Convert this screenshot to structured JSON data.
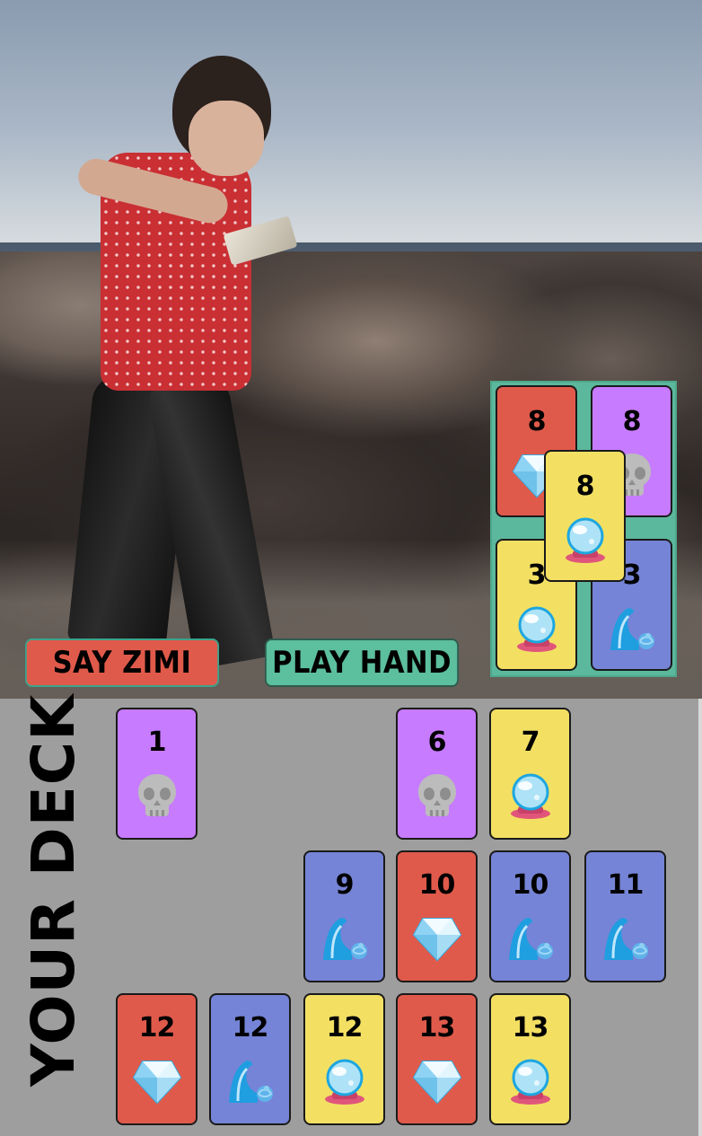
{
  "buttons": {
    "say_zimi": "SAY ZIMI",
    "play_hand": "PLAY HAND"
  },
  "deck": {
    "label": "YOUR DECK",
    "cards": [
      {
        "value": "1",
        "color": "purple",
        "icon": "skull-icon"
      },
      {
        "value": "6",
        "color": "purple",
        "icon": "skull-icon"
      },
      {
        "value": "7",
        "color": "yellow",
        "icon": "crystal-ball-icon"
      },
      {
        "value": "9",
        "color": "blue",
        "icon": "wave-icon"
      },
      {
        "value": "10",
        "color": "red",
        "icon": "diamond-icon"
      },
      {
        "value": "10",
        "color": "blue",
        "icon": "wave-icon"
      },
      {
        "value": "11",
        "color": "blue",
        "icon": "wave-icon"
      },
      {
        "value": "12",
        "color": "red",
        "icon": "diamond-icon"
      },
      {
        "value": "12",
        "color": "blue",
        "icon": "wave-icon"
      },
      {
        "value": "12",
        "color": "yellow",
        "icon": "crystal-ball-icon"
      },
      {
        "value": "13",
        "color": "red",
        "icon": "diamond-icon"
      },
      {
        "value": "13",
        "color": "yellow",
        "icon": "crystal-ball-icon"
      }
    ]
  },
  "table": {
    "cards": [
      {
        "value": "8",
        "color": "red",
        "icon": "diamond-icon"
      },
      {
        "value": "8",
        "color": "purple",
        "icon": "skull-icon"
      },
      {
        "value": "3",
        "color": "yellow",
        "icon": "crystal-ball-icon"
      },
      {
        "value": "3",
        "color": "blue",
        "icon": "wave-icon"
      },
      {
        "value": "8",
        "color": "yellow",
        "icon": "crystal-ball-icon"
      }
    ]
  },
  "colors": {
    "red": "#e05a4b",
    "purple": "#c77bff",
    "yellow": "#f3e063",
    "blue": "#7584d6",
    "green": "#5cbf9d",
    "deck_background": "#9e9e9e"
  }
}
